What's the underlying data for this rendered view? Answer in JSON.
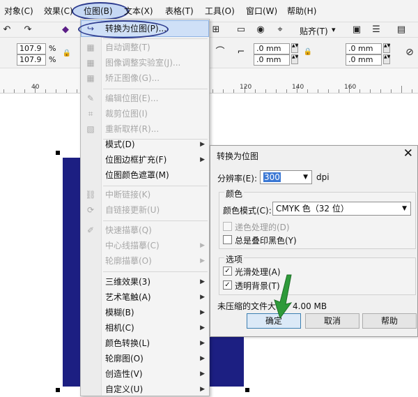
{
  "menubar": {
    "items": [
      {
        "label": "对象(C)"
      },
      {
        "label": "效果(C)"
      },
      {
        "label": "位图(B)"
      },
      {
        "label": "文本(X)"
      },
      {
        "label": "表格(T)"
      },
      {
        "label": "工具(O)"
      },
      {
        "label": "窗口(W)"
      },
      {
        "label": "帮助(H)"
      }
    ]
  },
  "toolbar": {
    "snap_label": "贴齐(T)",
    "width_value": "107.9",
    "height_value": "107.9",
    "percent_unit": "%",
    "outline1": ".0 mm",
    "outline2": ".0 mm",
    "outline3": ".0 mm",
    "outline4": ".0 mm"
  },
  "ruler": {
    "labels": [
      "40",
      "120",
      "140",
      "160"
    ]
  },
  "bitmap_menu": {
    "items": [
      {
        "label": "转换为位图(P)...",
        "enabled": true,
        "submenu": false
      },
      {
        "label": "自动调整(T)",
        "enabled": false,
        "submenu": false
      },
      {
        "label": "图像调整实验室(J)...",
        "enabled": false,
        "submenu": false
      },
      {
        "label": "矫正图像(G)...",
        "enabled": false,
        "submenu": false
      },
      {
        "label": "编辑位图(E)...",
        "enabled": false,
        "submenu": false
      },
      {
        "label": "裁剪位图(I)",
        "enabled": false,
        "submenu": false
      },
      {
        "label": "重新取样(R)...",
        "enabled": false,
        "submenu": false
      },
      {
        "label": "模式(D)",
        "enabled": true,
        "submenu": true
      },
      {
        "label": "位图边框扩充(F)",
        "enabled": true,
        "submenu": true
      },
      {
        "label": "位图颜色遮罩(M)",
        "enabled": true,
        "submenu": false
      },
      {
        "label": "中断链接(K)",
        "enabled": false,
        "submenu": false
      },
      {
        "label": "自链接更新(U)",
        "enabled": false,
        "submenu": false
      },
      {
        "label": "快速描摹(Q)",
        "enabled": false,
        "submenu": false
      },
      {
        "label": "中心线描摹(C)",
        "enabled": false,
        "submenu": true
      },
      {
        "label": "轮廓描摹(O)",
        "enabled": false,
        "submenu": true
      },
      {
        "label": "三维效果(3)",
        "enabled": true,
        "submenu": true
      },
      {
        "label": "艺术笔触(A)",
        "enabled": true,
        "submenu": true
      },
      {
        "label": "模糊(B)",
        "enabled": true,
        "submenu": true
      },
      {
        "label": "相机(C)",
        "enabled": true,
        "submenu": true
      },
      {
        "label": "颜色转换(L)",
        "enabled": true,
        "submenu": true
      },
      {
        "label": "轮廓图(O)",
        "enabled": true,
        "submenu": true
      },
      {
        "label": "创造性(V)",
        "enabled": true,
        "submenu": true
      },
      {
        "label": "自定义(U)",
        "enabled": true,
        "submenu": true
      }
    ]
  },
  "dialog": {
    "title": "转换为位图",
    "resolution_label": "分辨率(E):",
    "resolution_value": "300",
    "resolution_unit": "dpi",
    "color_group_title": "颜色",
    "color_mode_label": "颜色模式(C):",
    "color_mode_value": "CMYK 色（32 位）",
    "dither_label": "递色处理的(D)",
    "dither_checked": false,
    "always_overprint_label": "总是叠印黑色(Y)",
    "always_overprint_checked": false,
    "options_group_title": "选项",
    "antialias_label": "光滑处理(A)",
    "antialias_checked": true,
    "transparent_label": "透明背景(T)",
    "transparent_checked": true,
    "file_size_text": "未压缩的文件大小：4.00 MB",
    "ok_label": "确定",
    "cancel_label": "取消",
    "help_label": "帮助"
  },
  "colors": {
    "rectangle_fill": "#1c1f82",
    "annotation_outline": "#2d3b8e",
    "annotation_arrow": "#2e9a3a"
  }
}
